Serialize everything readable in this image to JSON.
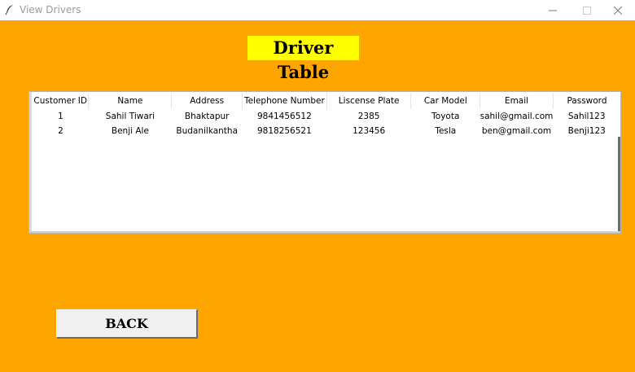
{
  "window": {
    "title": "View Drivers",
    "icon": "feather-icon",
    "controls": [
      "minimize-icon",
      "maximize-icon",
      "close-icon"
    ]
  },
  "heading": "Driver Table",
  "table": {
    "columns": [
      "Customer ID",
      "Name",
      "Address",
      "Telephone Number",
      "Liscense Plate",
      "Car Model",
      "Email",
      "Password"
    ],
    "rows": [
      [
        "1",
        "Sahil Tiwari",
        "Bhaktapur",
        "9841456512",
        "2385",
        "Toyota",
        "sahil@gmail.com",
        "Sahil123"
      ],
      [
        "2",
        "Benji Ale",
        "Budanilkantha",
        "9818256521",
        "123456",
        "Tesla",
        "ben@gmail.com",
        "Benji123"
      ]
    ]
  },
  "back_button": "BACK",
  "colors": {
    "background": "#ffa500",
    "heading_bg": "#ffff00",
    "button_bg": "#f0f0f0"
  }
}
